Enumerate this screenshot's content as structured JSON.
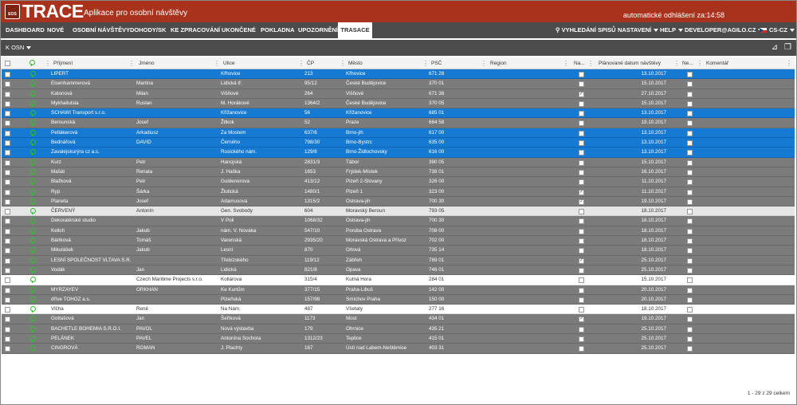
{
  "header": {
    "app_name": "TRACE",
    "logo_text": "EOS",
    "subtitle": "Aplikace pro osobní návštěvy",
    "logout_text": "automatické odhlášení za:14:58"
  },
  "nav": {
    "items": [
      "DASHBOARD",
      "NOVÉ",
      "OSOBNÍ NÁVŠTĚVY",
      "DOHODY/SK",
      "KE ZPRACOVÁNÍ",
      "UKONČENÉ",
      "POKLADNA",
      "UPOZORNĚNÍ",
      "TRASACE"
    ],
    "active": "TRASACE",
    "search_label": "VYHLEDÁNÍ SPISŮ",
    "settings_label": "NASTAVENÍ",
    "help_label": "HELP",
    "user_label": "DEVELOPER@AGILO.CZ",
    "lang_label": "CS-CZ"
  },
  "toolbar": {
    "filter_label": "K OSN"
  },
  "table": {
    "columns": [
      "Příjmení",
      "Jméno",
      "Ulice",
      "ČP",
      "Město",
      "PSČ",
      "Region",
      "Na...",
      "Plánované datum návštěvy",
      "Ne...",
      "Komentář"
    ],
    "rows": [
      {
        "style": "blue",
        "prijmeni": "LIPERT",
        "jmeno": "",
        "ulice": "Křhovice",
        "cp": "213",
        "mesto": "Křhovice",
        "psc": "671 28",
        "na": false,
        "datum": "13.10.2017"
      },
      {
        "style": "gray",
        "prijmeni": "Eisenhammerová",
        "jmeno": "Martina",
        "ulice": "Lidická tř.",
        "cp": "95/12",
        "mesto": "České Budějovice",
        "psc": "370 01",
        "na": false,
        "datum": "15.10.2017"
      },
      {
        "style": "gray",
        "prijmeni": "Katonová",
        "jmeno": "Milan",
        "ulice": "Višňové",
        "cp": "264",
        "mesto": "Višňové",
        "psc": "671 38",
        "na": true,
        "datum": "27.10.2017"
      },
      {
        "style": "gray",
        "prijmeni": "Mykhailutsia",
        "jmeno": "Ruslan",
        "ulice": "M. Horákové",
        "cp": "1364/2",
        "mesto": "České Budějovice",
        "psc": "370 05",
        "na": false,
        "datum": "15.10.2017"
      },
      {
        "style": "blue",
        "prijmeni": "SCHAWI Transport s.r.o.",
        "jmeno": "",
        "ulice": "Křižanovice",
        "cp": "56",
        "mesto": "Křižanovice",
        "psc": "685 01",
        "na": false,
        "datum": "13.10.2017"
      },
      {
        "style": "gray",
        "prijmeni": "Berounská",
        "jmeno": "Josef",
        "ulice": "Žitkok",
        "cp": "52",
        "mesto": "Praze",
        "psc": "664 58",
        "na": false,
        "datum": "19.10.2017"
      },
      {
        "style": "blue",
        "prijmeni": "Petlákerová",
        "jmeno": "Arkadiusz",
        "ulice": "Za Mostem",
        "cp": "637/8",
        "mesto": "Brno-jih",
        "psc": "617 00",
        "na": false,
        "datum": "13.10.2017"
      },
      {
        "style": "blue",
        "prijmeni": "Bednářová",
        "jmeno": "DAVID",
        "ulice": "Černého",
        "cp": "798/30",
        "mesto": "Brno-Bystrc",
        "psc": "635 00",
        "na": false,
        "datum": "13.10.2017"
      },
      {
        "style": "blue",
        "prijmeni": "Zavalejskurýra cz a.s.",
        "jmeno": "",
        "ulice": "Rosického nám.",
        "cp": "129/8",
        "mesto": "Brno-Židlochovsky",
        "psc": "616 00",
        "na": false,
        "datum": "13.10.2017"
      },
      {
        "style": "gray",
        "prijmeni": "Kurz",
        "jmeno": "Petr",
        "ulice": "Hanojská",
        "cp": "2831/3",
        "mesto": "Tábor",
        "psc": "390 05",
        "na": false,
        "datum": "15.10.2017"
      },
      {
        "style": "gray",
        "prijmeni": "Mašát",
        "jmeno": "Renata",
        "ulice": "J. Haška",
        "cp": "1653",
        "mesto": "Frýdek-Místek",
        "psc": "738 01",
        "na": false,
        "datum": "16.10.2017"
      },
      {
        "style": "gray",
        "prijmeni": "Blažková",
        "jmeno": "Petr",
        "ulice": "Guldenerova",
        "cp": "413/12",
        "mesto": "Plzeň 2-Slovany",
        "psc": "326 00",
        "na": false,
        "datum": "11.10.2017"
      },
      {
        "style": "gray",
        "prijmeni": "Ryp",
        "jmeno": "Šárka",
        "ulice": "Žlutická",
        "cp": "1480/1",
        "mesto": "Plzeň 1",
        "psc": "323 00",
        "na": true,
        "datum": "11.10.2017"
      },
      {
        "style": "gray",
        "prijmeni": "Planeta",
        "jmeno": "Josef",
        "ulice": "Adamusova",
        "cp": "1315/2",
        "mesto": "Ostrava-jih",
        "psc": "700 30",
        "na": true,
        "datum": "19.10.2017"
      },
      {
        "style": "light",
        "prijmeni": "ČERVENÝ",
        "jmeno": "Antonín",
        "ulice": "Gen. Svobody",
        "cp": "604",
        "mesto": "Moravský Beroun",
        "psc": "793 05",
        "na": false,
        "datum": "18.10.2017"
      },
      {
        "style": "gray",
        "prijmeni": "Dekoratérské studio",
        "jmeno": "",
        "ulice": "V Poli",
        "cp": "1068/32",
        "mesto": "Ostrava-jih",
        "psc": "700 30",
        "na": false,
        "datum": "18.10.2017"
      },
      {
        "style": "gray",
        "prijmeni": "Kellch",
        "jmeno": "Jakub",
        "ulice": "nám. V. Nováka",
        "cp": "547/10",
        "mesto": "Poruba Ostrava",
        "psc": "708 00",
        "na": false,
        "datum": "18.10.2017"
      },
      {
        "style": "gray",
        "prijmeni": "Bártková",
        "jmeno": "Tomáš",
        "ulice": "Varenská",
        "cp": "2935/20",
        "mesto": "Moravská Ostrava a Přívoz",
        "psc": "702 00",
        "na": false,
        "datum": "18.10.2017"
      },
      {
        "style": "gray",
        "prijmeni": "Mikulášek",
        "jmeno": "Jakub",
        "ulice": "Lesní",
        "cp": "870",
        "mesto": "Orlová",
        "psc": "735 14",
        "na": false,
        "datum": "18.10.2017"
      },
      {
        "style": "gray",
        "prijmeni": "LESNÍ SPOLEČNOST VLTAVA S.R.O.",
        "jmeno": "",
        "ulice": "Třebízského",
        "cp": "119/12",
        "mesto": "Zábřeh",
        "psc": "789 01",
        "na": true,
        "datum": "25.10.2017"
      },
      {
        "style": "gray",
        "prijmeni": "Vodák",
        "jmeno": "Jan",
        "ulice": "Lidická",
        "cp": "821/8",
        "mesto": "Opava",
        "psc": "746 01",
        "na": false,
        "datum": "25.10.2017"
      },
      {
        "style": "white",
        "prijmeni": "",
        "jmeno": "Czech Maritime Projects s.r.o.",
        "ulice": "Kollárova",
        "cp": "315/4",
        "mesto": "Kutná Hora",
        "psc": "284 01",
        "na": false,
        "datum": "15.10.2017"
      },
      {
        "style": "gray",
        "prijmeni": "MYRZAYEV",
        "jmeno": "ORKHAN",
        "ulice": "Ke Kurtům",
        "cp": "377/15",
        "mesto": "Praha-Libuš",
        "psc": "142 00",
        "na": false,
        "datum": "20.10.2017"
      },
      {
        "style": "gray",
        "prijmeni": "dříve TOHOZ a.s.",
        "jmeno": "",
        "ulice": "Plzeňská",
        "cp": "157/98",
        "mesto": "Smíchov Praha",
        "psc": "150 00",
        "na": false,
        "datum": "20.10.2017"
      },
      {
        "style": "white",
        "prijmeni": "Vlčha",
        "jmeno": "René",
        "ulice": "Na Nám.",
        "cp": "487",
        "mesto": "Všetaty",
        "psc": "277 16",
        "na": false,
        "datum": "18.10.2017"
      },
      {
        "style": "gray",
        "prijmeni": "Gottašová",
        "jmeno": "Jan",
        "ulice": "Šeříková",
        "cp": "1173",
        "mesto": "Most",
        "psc": "434 01",
        "na": true,
        "datum": "19.10.2017"
      },
      {
        "style": "gray",
        "prijmeni": "BACHETLE BOHEMIA S.R.O.I.",
        "jmeno": "PAVOL",
        "ulice": "Nová výstavba",
        "cp": "179",
        "mesto": "Ohrnice",
        "psc": "435 21",
        "na": false,
        "datum": "25.10.2017"
      },
      {
        "style": "gray",
        "prijmeni": "PELÁNEK",
        "jmeno": "PAVEL",
        "ulice": "Antonína Sochora",
        "cp": "1312/23",
        "mesto": "Teplice",
        "psc": "415 01",
        "na": false,
        "datum": "25.10.2017"
      },
      {
        "style": "gray",
        "prijmeni": "CINGROVÁ",
        "jmeno": "ROMAN",
        "ulice": "J. Plachty",
        "cp": "167",
        "mesto": "Ústí nad Labem-Neštěmice",
        "psc": "403 31",
        "na": false,
        "datum": "25.10.2017"
      }
    ]
  },
  "footer": {
    "count_text": "1 - 29 z 29 celkem"
  }
}
